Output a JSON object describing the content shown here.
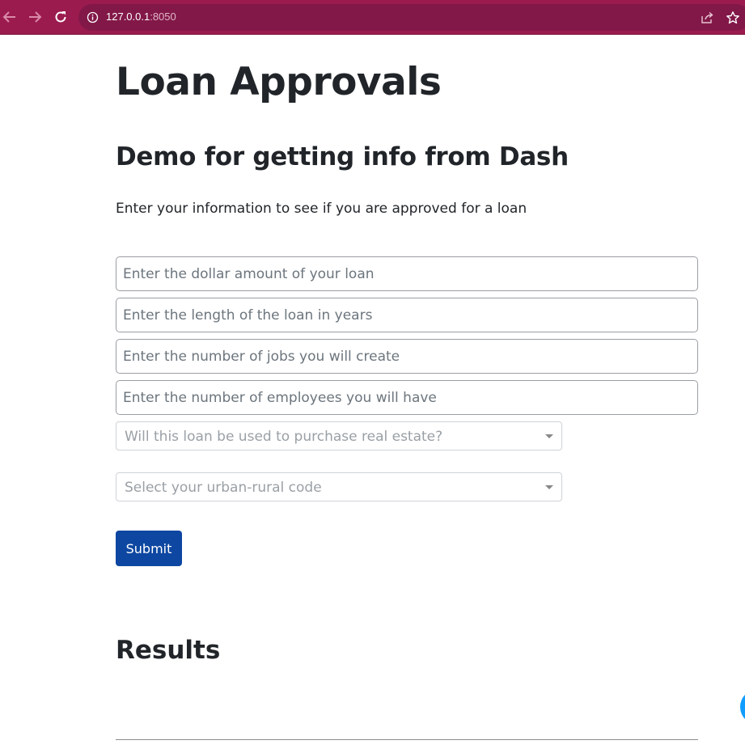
{
  "browser": {
    "url_host": "127.0.0.1",
    "url_port": ":8050",
    "back_icon": "arrow-left-icon",
    "forward_icon": "arrow-right-icon",
    "reload_icon": "reload-icon",
    "info_icon": "info-icon",
    "share_icon": "share-icon",
    "bookmark_icon": "star-icon",
    "toolbar_color": "#9c1b4f"
  },
  "page": {
    "title": "Loan Approvals",
    "subtitle": "Demo for getting info from Dash",
    "intro": "Enter your information to see if you are approved for a loan"
  },
  "form": {
    "loan_amount_placeholder": "Enter the dollar amount of your loan",
    "loan_length_placeholder": "Enter the length of the loan in years",
    "jobs_created_placeholder": "Enter the number of jobs you will create",
    "employees_placeholder": "Enter the number of employees you will have",
    "real_estate_placeholder": "Will this loan be used to purchase real estate?",
    "urban_rural_placeholder": "Select your urban-rural code",
    "submit_label": "Submit",
    "submit_color": "#0d47a1"
  },
  "results": {
    "heading": "Results"
  }
}
